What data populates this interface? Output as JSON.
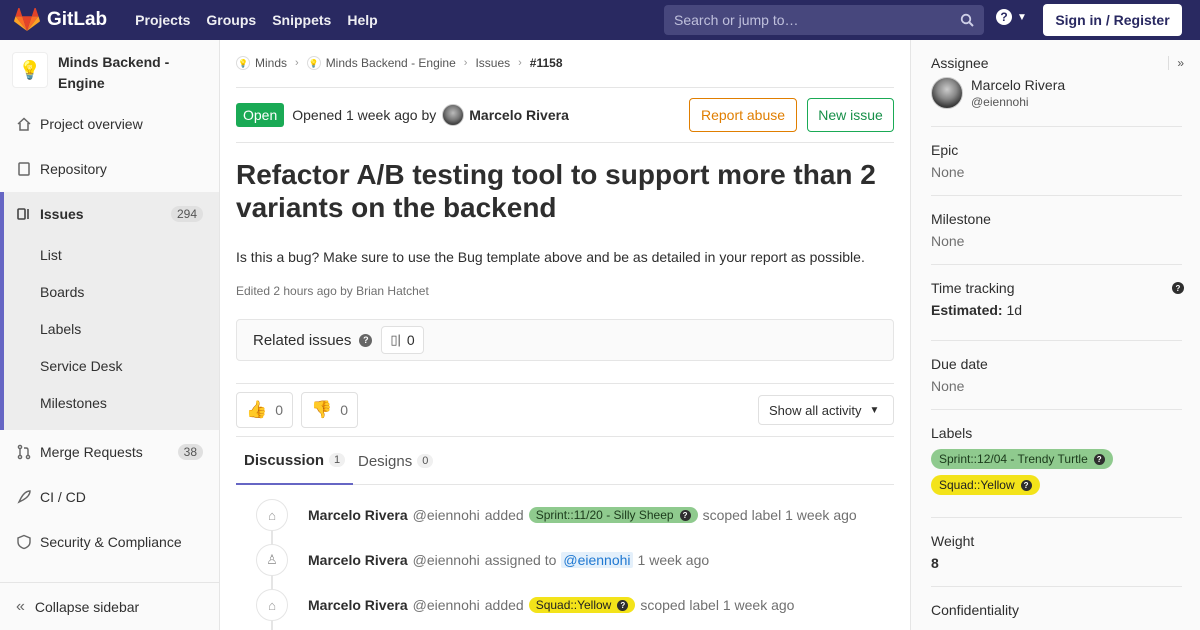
{
  "navbar": {
    "brand": "GitLab",
    "links": [
      "Projects",
      "Groups",
      "Snippets",
      "Help"
    ],
    "search_placeholder": "Search or jump to…",
    "signin_label": "Sign in / Register"
  },
  "sidebar": {
    "project_name": "Minds Backend - Engine",
    "items": [
      {
        "label": "Project overview",
        "icon": "home-icon"
      },
      {
        "label": "Repository",
        "icon": "doc-icon"
      },
      {
        "label": "Issues",
        "icon": "issues-icon",
        "count": "294"
      },
      {
        "label": "Merge Requests",
        "icon": "merge-request-icon",
        "count": "38"
      },
      {
        "label": "CI / CD",
        "icon": "rocket-icon"
      },
      {
        "label": "Security & Compliance",
        "icon": "shield-icon"
      }
    ],
    "sub_items": [
      "List",
      "Boards",
      "Labels",
      "Service Desk",
      "Milestones"
    ],
    "collapse_label": "Collapse sidebar"
  },
  "breadcrumb": [
    "Minds",
    "Minds Backend - Engine",
    "Issues",
    "#1158"
  ],
  "issue": {
    "status": "Open",
    "opened_text": "Opened 1 week ago by",
    "author": "Marcelo Rivera",
    "report_abuse_label": "Report abuse",
    "new_issue_label": "New issue",
    "title": "Refactor A/B testing tool to support more than 2 variants on the backend",
    "description": "Is this a bug? Make sure to use the Bug template above and be as detailed in your report as possible.",
    "edited": "Edited 2 hours ago by Brian Hatchet",
    "related_title": "Related issues",
    "related_count": "0",
    "thumbs_up_count": "0",
    "thumbs_down_count": "0",
    "show_activity_label": "Show all activity"
  },
  "tabs": [
    {
      "label": "Discussion",
      "count": "1"
    },
    {
      "label": "Designs",
      "count": "0"
    }
  ],
  "notes": [
    {
      "author": "Marcelo Rivera",
      "user": "@eiennohi",
      "text1": "added",
      "label": "Sprint::11/20 - Silly Sheep",
      "text2": "scoped label 1 week ago"
    },
    {
      "author": "Marcelo Rivera",
      "user": "@eiennohi",
      "text1": "assigned to",
      "mention": "@eiennohi",
      "text2": "1 week ago"
    },
    {
      "author": "Marcelo Rivera",
      "user": "@eiennohi",
      "text1": "added",
      "label": "Squad::Yellow",
      "text2": "scoped label 1 week ago"
    }
  ],
  "right_sidebar": {
    "assignee_title": "Assignee",
    "assignee_name": "Marcelo Rivera",
    "assignee_user": "@eiennohi",
    "epic_title": "Epic",
    "epic_value": "None",
    "milestone_title": "Milestone",
    "milestone_value": "None",
    "time_title": "Time tracking",
    "estimated_label": "Estimated:",
    "estimated_value": "1d",
    "due_title": "Due date",
    "due_value": "None",
    "labels_title": "Labels",
    "labels": [
      "Sprint::12/04 - Trendy Turtle",
      "Squad::Yellow"
    ],
    "weight_title": "Weight",
    "weight_value": "8",
    "confidentiality_title": "Confidentiality"
  },
  "colors": {
    "navbar": "#292961",
    "accent": "#6666c4",
    "open_green": "#1aaa55",
    "abuse_orange": "#e07e00",
    "label_green": "#8fca8e",
    "label_yellow": "#f3e31a"
  }
}
